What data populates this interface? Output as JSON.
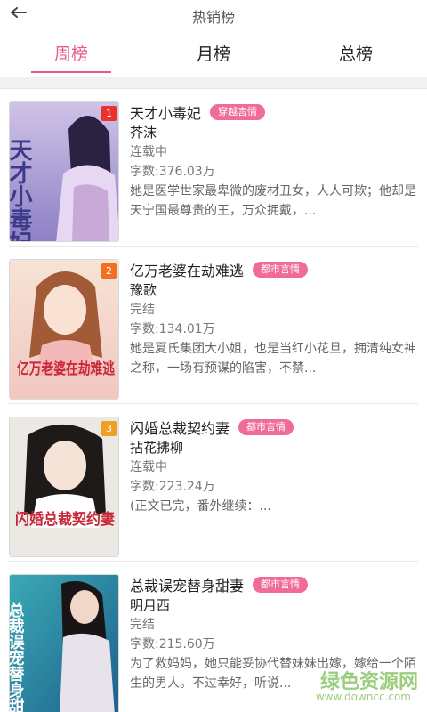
{
  "header": {
    "title": "热销榜",
    "back_icon": "back-arrow-icon"
  },
  "tabs": [
    {
      "label": "周榜",
      "active": true
    },
    {
      "label": "月榜",
      "active": false
    },
    {
      "label": "总榜",
      "active": false
    }
  ],
  "books": [
    {
      "rank": "1",
      "cover_title": "天才小毒妃",
      "title": "天才小毒妃",
      "tag": "穿越言情",
      "author": "芥沫",
      "status": "连载中",
      "words": "字数:376.03万",
      "desc": "她是医学世家最卑微的废材丑女，人人可欺；他却是天宁国最尊贵的王，万众拥戴，..."
    },
    {
      "rank": "2",
      "cover_title": "亿万老婆在劫难逃",
      "title": "亿万老婆在劫难逃",
      "tag": "都市言情",
      "author": "豫歌",
      "status": "完结",
      "words": "字数:134.01万",
      "desc": "她是夏氏集团大小姐，也是当红小花旦，拥清纯女神之称，一场有预谋的陷害，不禁..."
    },
    {
      "rank": "3",
      "cover_title": "闪婚总裁契约妻",
      "title": "闪婚总裁契约妻",
      "tag": "都市言情",
      "author": "拈花拂柳",
      "status": "连载中",
      "words": "字数:223.24万",
      "desc": "(正文已完，番外继续：..."
    },
    {
      "rank": "",
      "cover_title": "总裁误宠替身甜妻",
      "title": "总裁误宠替身甜妻",
      "tag": "都市言情",
      "author": "明月西",
      "status": "完结",
      "words": "字数:215.60万",
      "desc": "为了救妈妈，她只能妥协代替妹妹出嫁，嫁给一个陌生的男人。不过幸好，听说..."
    }
  ],
  "watermark": {
    "big": "绿色资源网",
    "small": "www.downcc.com"
  },
  "colors": {
    "accent": "#e85a83",
    "tag": "#f06b95",
    "rank": "#f07020"
  }
}
